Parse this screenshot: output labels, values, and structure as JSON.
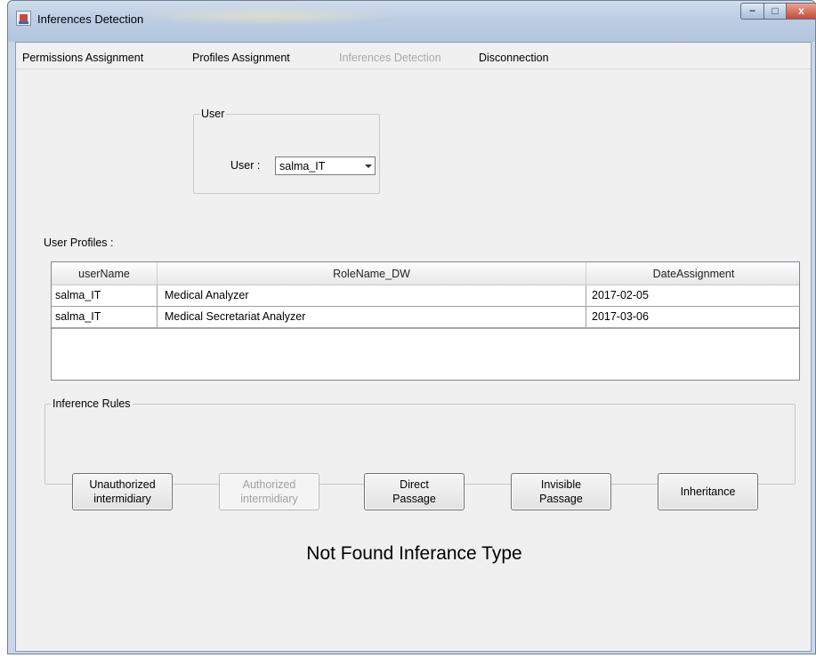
{
  "window": {
    "title": "Inferences Detection",
    "controls": {
      "minimize": "−",
      "maximize": "□",
      "close": "x"
    }
  },
  "menu": {
    "items": [
      {
        "label": "Permissions Assignment",
        "enabled": true
      },
      {
        "label": "Profiles Assignment",
        "enabled": true
      },
      {
        "label": "Inferences Detection",
        "enabled": false
      },
      {
        "label": "Disconnection",
        "enabled": true
      }
    ]
  },
  "user_group": {
    "legend": "User",
    "label": "User :",
    "selected": "salma_IT"
  },
  "profiles": {
    "label": "User Profiles :",
    "columns": [
      "userName",
      "RoleName_DW",
      "DateAssignment"
    ],
    "rows": [
      [
        "salma_IT",
        "Medical Analyzer",
        "2017-02-05"
      ],
      [
        "salma_IT",
        "Medical Secretariat Analyzer",
        "2017-03-06"
      ]
    ]
  },
  "rules": {
    "legend": "Inference Rules",
    "buttons": [
      {
        "line1": "Unauthorized",
        "line2": "intermidiary",
        "enabled": true
      },
      {
        "line1": "Authorized",
        "line2": "intermidiary",
        "enabled": false
      },
      {
        "line1": "Direct",
        "line2": "Passage",
        "enabled": true
      },
      {
        "line1": "Invisible",
        "line2": "Passage",
        "enabled": true
      },
      {
        "line1": "Inheritance",
        "line2": "",
        "enabled": true
      }
    ]
  },
  "result_text": "Not Found Inferance Type"
}
